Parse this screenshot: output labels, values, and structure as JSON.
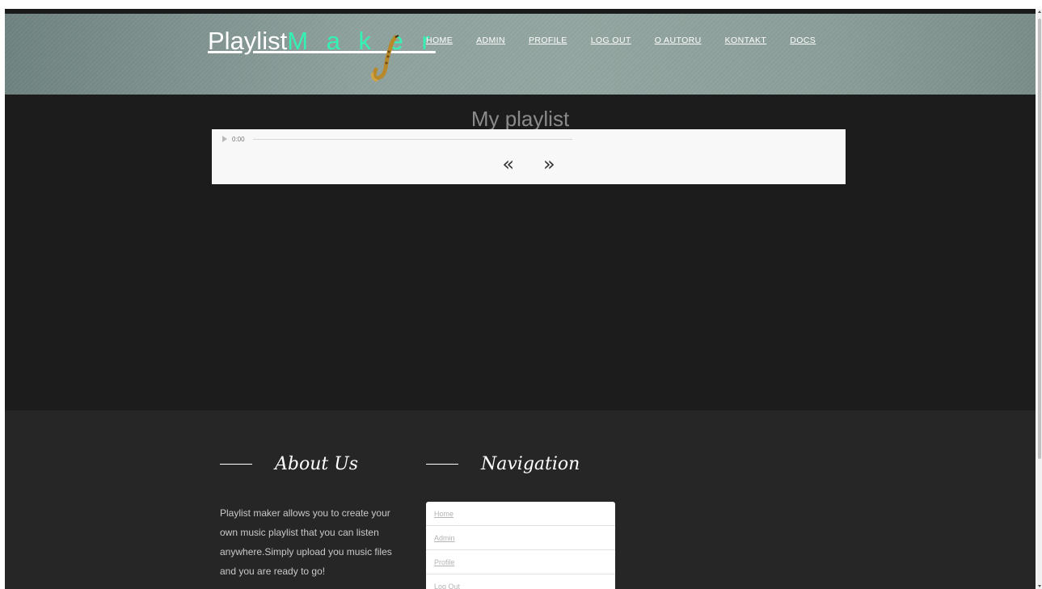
{
  "header": {
    "logo_part1": "Playlist",
    "logo_part2": "M a k e r",
    "nav": [
      "HOME",
      "ADMIN",
      "PROFILE",
      "LOG OUT",
      "O AUTORU",
      "KONTAKT",
      "DOCS"
    ]
  },
  "main": {
    "title": "My playlist",
    "audio_time": "0:00",
    "prev_label": "«",
    "next_label": "»"
  },
  "footer": {
    "about_title": "About Us",
    "about_text": "Playlist maker allows you to create your own music playlist that you can listen anywhere.Simply upload you music files and you are ready to go!",
    "nav_title": "Navigation",
    "nav_items": [
      "Home",
      "Admin",
      "Profile",
      "Log Out"
    ]
  },
  "colors": {
    "accent": "#34f2b4",
    "main_bg": "#1c1c1c",
    "footer_bg": "#262626"
  },
  "icons": [
    "saxophone-icon",
    "play-icon"
  ]
}
